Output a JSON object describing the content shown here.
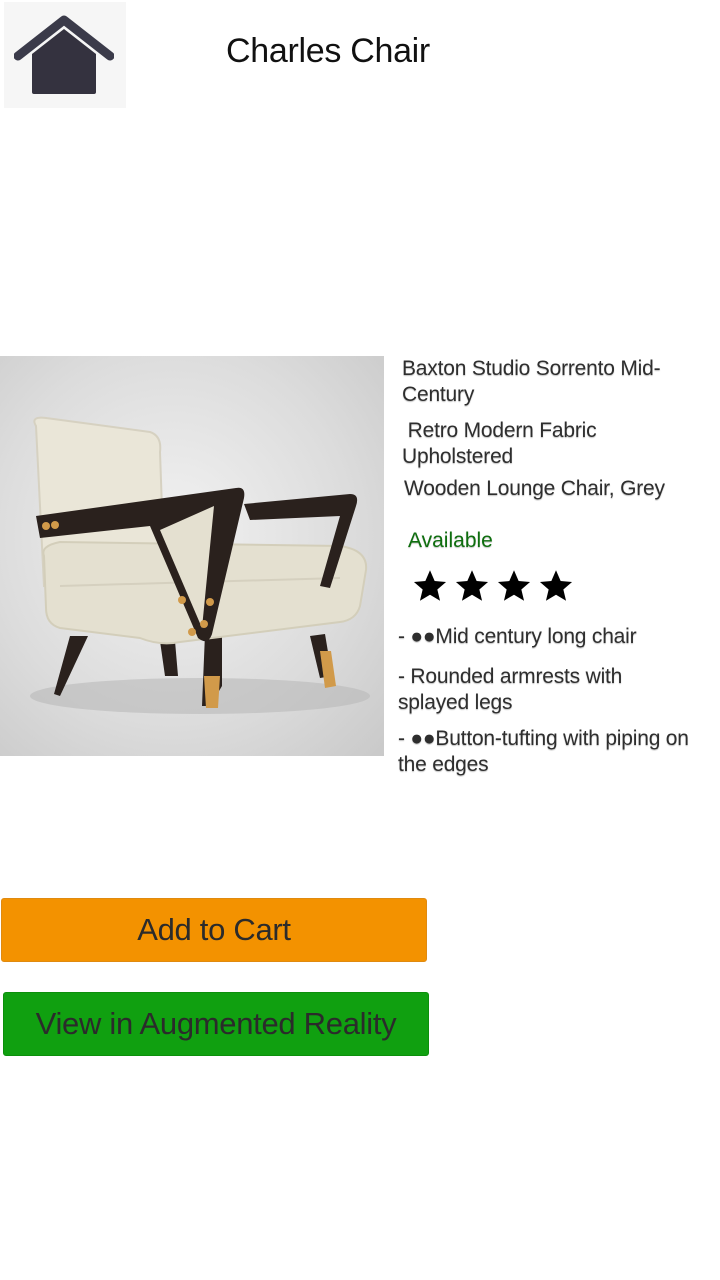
{
  "header": {
    "home_icon": "home-icon",
    "title": "Charles Chair"
  },
  "product": {
    "image_icon": "armchair-image",
    "description_lines": [
      "Baxton Studio Sorrento Mid-Century",
      " Retro Modern Fabric Upholstered",
      "Wooden Lounge Chair, Grey"
    ],
    "availability": "Available",
    "rating": 4,
    "rating_max": 4,
    "features": [
      "- ●●Mid century long chair",
      "- Rounded armrests with splayed legs",
      "- ●●Button-tufting with piping on the edges"
    ]
  },
  "actions": {
    "add_to_cart_label": "Add to Cart",
    "view_ar_label": "View in Augmented Reality"
  },
  "colors": {
    "cart_button": "#f39200",
    "ar_button": "#10a010",
    "available_text": "#0e6e0e"
  }
}
